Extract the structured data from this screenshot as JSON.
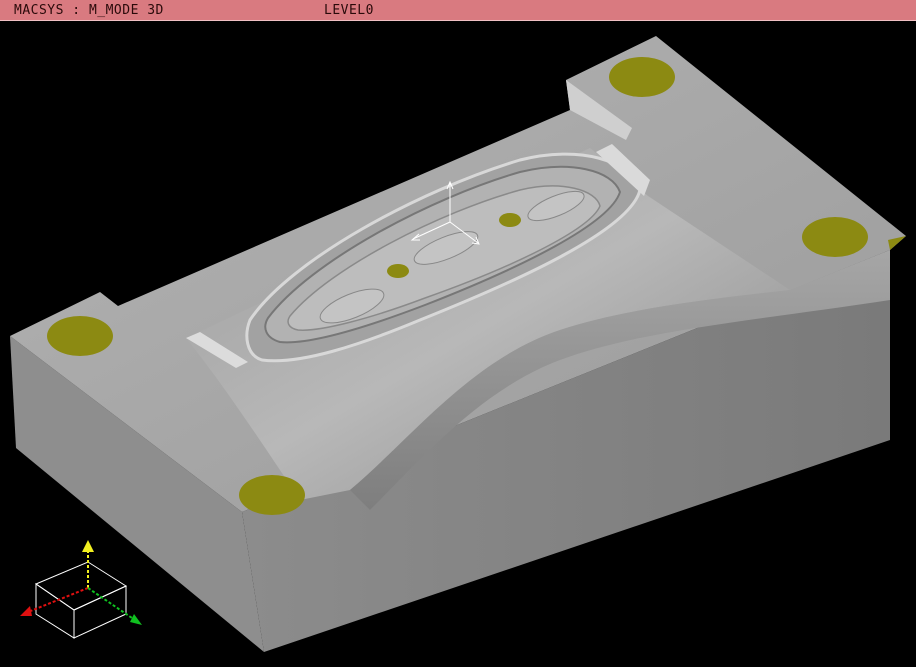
{
  "status_bar": {
    "system_text": "MACSYS : M_MODE 3D",
    "level_text": "LEVEL0",
    "background_color": "#d97a80"
  },
  "viewport": {
    "background_color": "#000000",
    "model": {
      "description_color_body": "#a8a8a8",
      "marker_color": "#8c8a12",
      "marker_count": 6
    },
    "axis_gizmo": {
      "x_axis_color": "#e01010",
      "y_axis_color": "#f2f020",
      "z_axis_color": "#10c020",
      "icons": [
        "x-axis-arrow-icon",
        "y-axis-arrow-icon",
        "z-axis-arrow-icon",
        "view-cube-icon"
      ]
    },
    "origin_triad": {
      "icons": [
        "origin-triad-icon"
      ]
    }
  }
}
